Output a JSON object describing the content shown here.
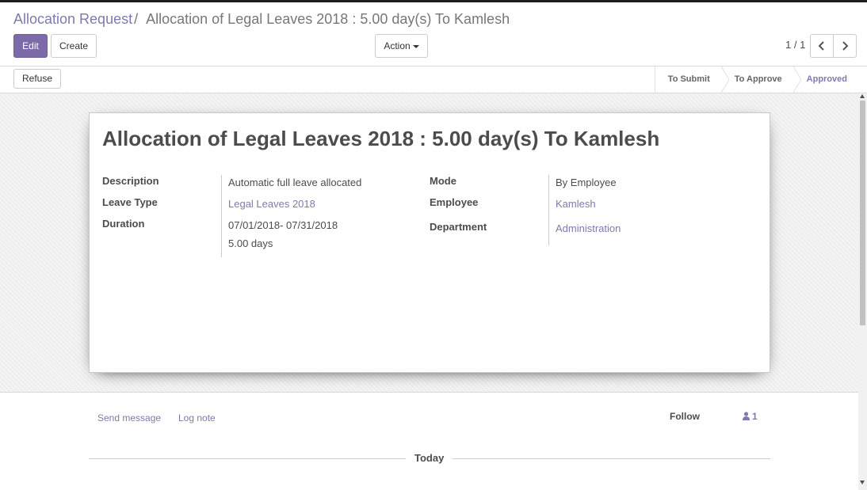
{
  "breadcrumb": {
    "parent": "Allocation Request",
    "separator": "/",
    "current": "Allocation of Legal Leaves 2018 : 5.00 day(s) To Kamlesh"
  },
  "toolbar": {
    "edit_label": "Edit",
    "create_label": "Create",
    "action_label": "Action"
  },
  "pager": {
    "value": "1 / 1"
  },
  "statusbar": {
    "refuse_label": "Refuse",
    "stages": [
      {
        "label": "To Submit",
        "active": false
      },
      {
        "label": "To Approve",
        "active": false
      },
      {
        "label": "Approved",
        "active": true
      }
    ]
  },
  "sheet": {
    "title": "Allocation of Legal Leaves 2018 : 5.00 day(s) To Kamlesh",
    "left_fields": {
      "description_label": "Description",
      "description_value": "Automatic full leave allocated",
      "leave_type_label": "Leave Type",
      "leave_type_value": "Legal Leaves 2018",
      "duration_label": "Duration",
      "duration_dates": "07/01/2018- 07/31/2018",
      "duration_days": "5.00 days"
    },
    "right_fields": {
      "mode_label": "Mode",
      "mode_value": "By Employee",
      "employee_label": "Employee",
      "employee_value": "Kamlesh",
      "department_label": "Department",
      "department_value": "Administration"
    }
  },
  "chatter": {
    "send_message_label": "Send message",
    "log_note_label": "Log note",
    "follow_label": "Follow",
    "followers_count": "1",
    "day_separator": "Today"
  },
  "colors": {
    "accent": "#7c7bad",
    "edit_button": "#7c6ba8"
  }
}
